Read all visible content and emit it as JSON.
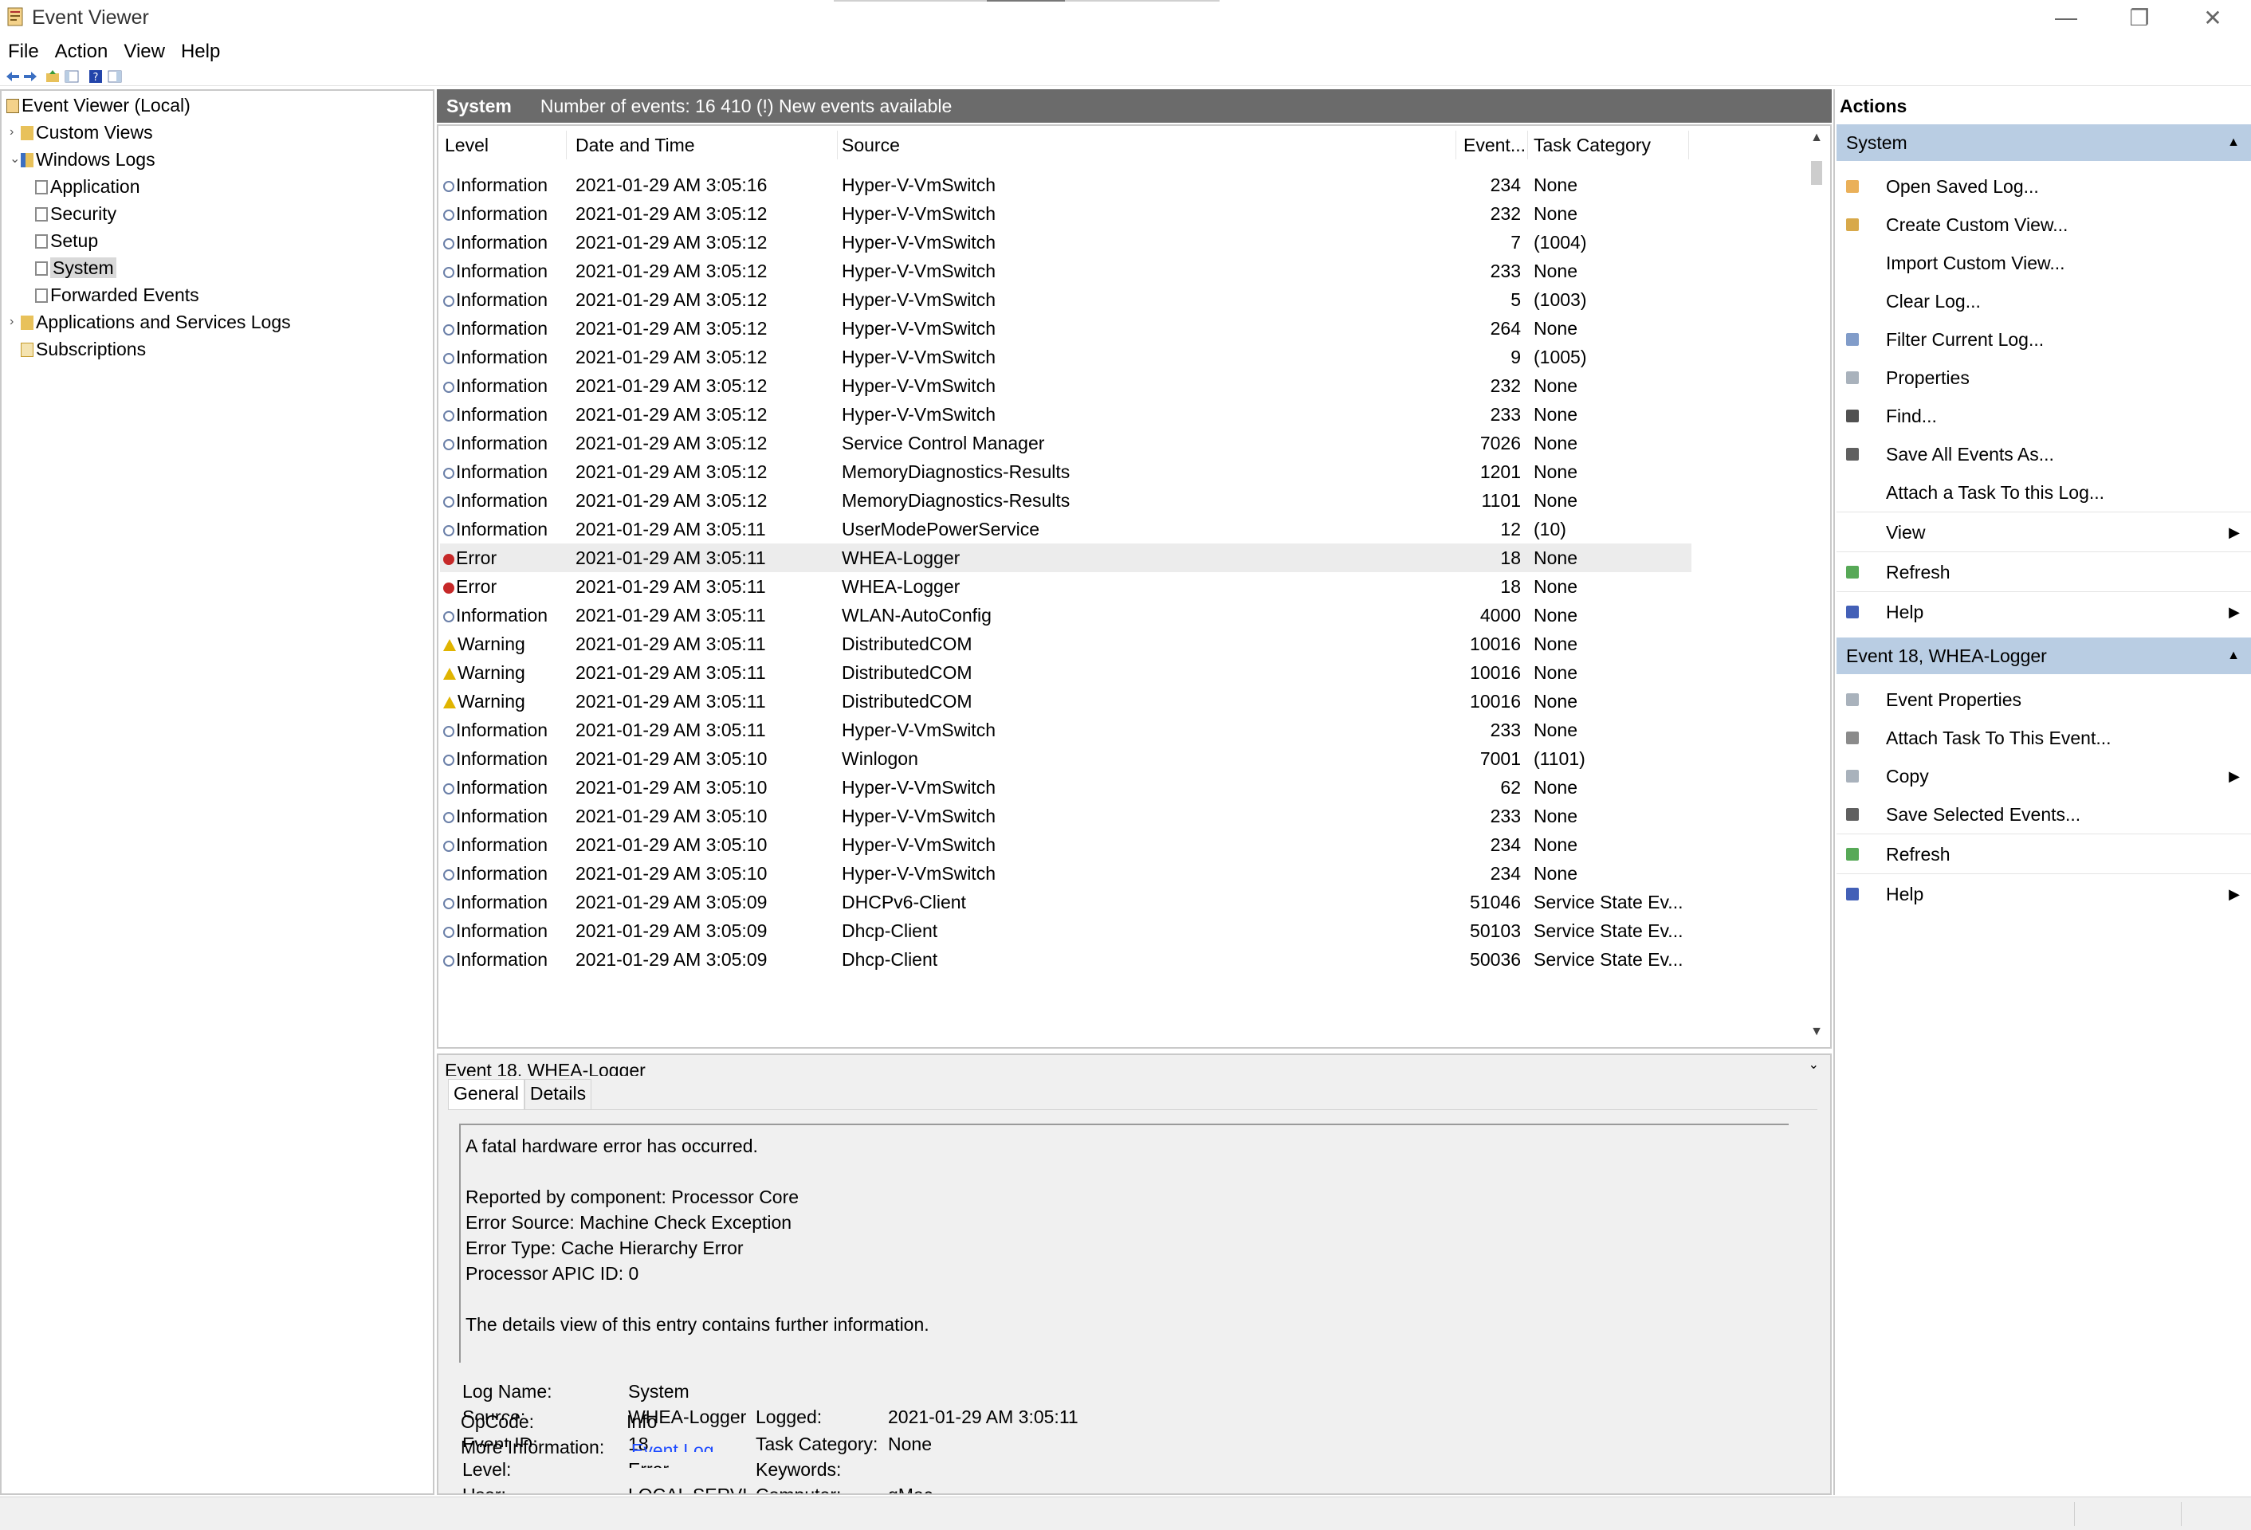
{
  "window": {
    "title": "Event Viewer",
    "controls": [
      "—",
      "❐",
      "✕"
    ]
  },
  "menu": [
    "File",
    "Action",
    "View",
    "Help"
  ],
  "tree": {
    "root": "Event Viewer (Local)",
    "custom_views": "Custom Views",
    "windows_logs": "Windows Logs",
    "application": "Application",
    "security": "Security",
    "setup": "Setup",
    "system": "System",
    "forwarded": "Forwarded Events",
    "app_services": "Applications and Services Logs",
    "subscriptions": "Subscriptions"
  },
  "header": {
    "log": "System",
    "count_text": "Number of events: 16 410 (!) New events available"
  },
  "columns": {
    "level": "Level",
    "date": "Date and Time",
    "source": "Source",
    "event": "Event...",
    "task": "Task Category"
  },
  "events": [
    {
      "level": "Information",
      "kind": "info",
      "date": "2021-01-29 AM 3:05:16",
      "source": "Hyper-V-VmSwitch",
      "id": "234",
      "task": "None"
    },
    {
      "level": "Information",
      "kind": "info",
      "date": "2021-01-29 AM 3:05:12",
      "source": "Hyper-V-VmSwitch",
      "id": "232",
      "task": "None"
    },
    {
      "level": "Information",
      "kind": "info",
      "date": "2021-01-29 AM 3:05:12",
      "source": "Hyper-V-VmSwitch",
      "id": "7",
      "task": "(1004)"
    },
    {
      "level": "Information",
      "kind": "info",
      "date": "2021-01-29 AM 3:05:12",
      "source": "Hyper-V-VmSwitch",
      "id": "233",
      "task": "None"
    },
    {
      "level": "Information",
      "kind": "info",
      "date": "2021-01-29 AM 3:05:12",
      "source": "Hyper-V-VmSwitch",
      "id": "5",
      "task": "(1003)"
    },
    {
      "level": "Information",
      "kind": "info",
      "date": "2021-01-29 AM 3:05:12",
      "source": "Hyper-V-VmSwitch",
      "id": "264",
      "task": "None"
    },
    {
      "level": "Information",
      "kind": "info",
      "date": "2021-01-29 AM 3:05:12",
      "source": "Hyper-V-VmSwitch",
      "id": "9",
      "task": "(1005)"
    },
    {
      "level": "Information",
      "kind": "info",
      "date": "2021-01-29 AM 3:05:12",
      "source": "Hyper-V-VmSwitch",
      "id": "232",
      "task": "None"
    },
    {
      "level": "Information",
      "kind": "info",
      "date": "2021-01-29 AM 3:05:12",
      "source": "Hyper-V-VmSwitch",
      "id": "233",
      "task": "None"
    },
    {
      "level": "Information",
      "kind": "info",
      "date": "2021-01-29 AM 3:05:12",
      "source": "Service Control Manager",
      "id": "7026",
      "task": "None"
    },
    {
      "level": "Information",
      "kind": "info",
      "date": "2021-01-29 AM 3:05:12",
      "source": "MemoryDiagnostics-Results",
      "id": "1201",
      "task": "None"
    },
    {
      "level": "Information",
      "kind": "info",
      "date": "2021-01-29 AM 3:05:12",
      "source": "MemoryDiagnostics-Results",
      "id": "1101",
      "task": "None"
    },
    {
      "level": "Information",
      "kind": "info",
      "date": "2021-01-29 AM 3:05:11",
      "source": "UserModePowerService",
      "id": "12",
      "task": "(10)"
    },
    {
      "level": "Error",
      "kind": "err",
      "date": "2021-01-29 AM 3:05:11",
      "source": "WHEA-Logger",
      "id": "18",
      "task": "None",
      "selected": true
    },
    {
      "level": "Error",
      "kind": "err",
      "date": "2021-01-29 AM 3:05:11",
      "source": "WHEA-Logger",
      "id": "18",
      "task": "None"
    },
    {
      "level": "Information",
      "kind": "info",
      "date": "2021-01-29 AM 3:05:11",
      "source": "WLAN-AutoConfig",
      "id": "4000",
      "task": "None"
    },
    {
      "level": "Warning",
      "kind": "warn",
      "date": "2021-01-29 AM 3:05:11",
      "source": "DistributedCOM",
      "id": "10016",
      "task": "None"
    },
    {
      "level": "Warning",
      "kind": "warn",
      "date": "2021-01-29 AM 3:05:11",
      "source": "DistributedCOM",
      "id": "10016",
      "task": "None"
    },
    {
      "level": "Warning",
      "kind": "warn",
      "date": "2021-01-29 AM 3:05:11",
      "source": "DistributedCOM",
      "id": "10016",
      "task": "None"
    },
    {
      "level": "Information",
      "kind": "info",
      "date": "2021-01-29 AM 3:05:11",
      "source": "Hyper-V-VmSwitch",
      "id": "233",
      "task": "None"
    },
    {
      "level": "Information",
      "kind": "info",
      "date": "2021-01-29 AM 3:05:10",
      "source": "Winlogon",
      "id": "7001",
      "task": "(1101)"
    },
    {
      "level": "Information",
      "kind": "info",
      "date": "2021-01-29 AM 3:05:10",
      "source": "Hyper-V-VmSwitch",
      "id": "62",
      "task": "None"
    },
    {
      "level": "Information",
      "kind": "info",
      "date": "2021-01-29 AM 3:05:10",
      "source": "Hyper-V-VmSwitch",
      "id": "233",
      "task": "None"
    },
    {
      "level": "Information",
      "kind": "info",
      "date": "2021-01-29 AM 3:05:10",
      "source": "Hyper-V-VmSwitch",
      "id": "234",
      "task": "None"
    },
    {
      "level": "Information",
      "kind": "info",
      "date": "2021-01-29 AM 3:05:10",
      "source": "Hyper-V-VmSwitch",
      "id": "234",
      "task": "None"
    },
    {
      "level": "Information",
      "kind": "info",
      "date": "2021-01-29 AM 3:05:09",
      "source": "DHCPv6-Client",
      "id": "51046",
      "task": "Service State Ev..."
    },
    {
      "level": "Information",
      "kind": "info",
      "date": "2021-01-29 AM 3:05:09",
      "source": "Dhcp-Client",
      "id": "50103",
      "task": "Service State Ev..."
    },
    {
      "level": "Information",
      "kind": "info",
      "date": "2021-01-29 AM 3:05:09",
      "source": "Dhcp-Client",
      "id": "50036",
      "task": "Service State Ev..."
    }
  ],
  "detail": {
    "title": "Event 18, WHEA-Logger",
    "tabs": {
      "general": "General",
      "details": "Details"
    },
    "message": [
      "A fatal hardware error has occurred.",
      "",
      "Reported by component: Processor Core",
      "Error Source: Machine Check Exception",
      "Error Type: Cache Hierarchy Error",
      "Processor APIC ID: 0",
      "",
      "The details view of this entry contains further information."
    ],
    "labels": {
      "log_name": "Log Name:",
      "source": "Source:",
      "event_id": "Event ID:",
      "level": "Level:",
      "user": "User:",
      "opcode": "OpCode:",
      "more_info": "More Information:",
      "logged": "Logged:",
      "task_category": "Task Category:",
      "keywords": "Keywords:",
      "computer": "Computer:"
    },
    "values": {
      "log_name": "System",
      "source": "WHEA-Logger",
      "event_id": "18",
      "level": "Error",
      "user": "LOCAL SERVICE",
      "opcode": "Info",
      "more_info": "Event Log Online Help",
      "logged": "2021-01-29 AM 3:05:11",
      "task_category": "None",
      "keywords": "",
      "computer": "gMac"
    }
  },
  "actions": {
    "title": "Actions",
    "section1": "System",
    "items1": [
      {
        "label": "Open Saved Log...",
        "icon": "folder-icon",
        "color": "#e6a23c"
      },
      {
        "label": "Create Custom View...",
        "icon": "filter-icon",
        "color": "#d19a2a"
      },
      {
        "label": "Import Custom View...",
        "icon": "",
        "color": ""
      },
      {
        "label": "Clear Log...",
        "icon": "",
        "color": ""
      },
      {
        "label": "Filter Current Log...",
        "icon": "filter-icon",
        "color": "#6b8bbf"
      },
      {
        "label": "Properties",
        "icon": "properties-icon",
        "color": "#9aa4b0"
      },
      {
        "label": "Find...",
        "icon": "binoculars-icon",
        "color": "#333"
      },
      {
        "label": "Save All Events As...",
        "icon": "save-icon",
        "color": "#444"
      },
      {
        "label": "Attach a Task To this Log...",
        "icon": "",
        "color": ""
      },
      {
        "label": "View",
        "icon": "",
        "color": "",
        "submenu": true
      },
      {
        "label": "Refresh",
        "icon": "refresh-icon",
        "color": "#3a9a3a"
      },
      {
        "label": "Help",
        "icon": "help-icon",
        "color": "#2244aa",
        "submenu": true
      }
    ],
    "section2": "Event 18, WHEA-Logger",
    "items2": [
      {
        "label": "Event Properties",
        "icon": "properties-icon",
        "color": "#9aa4b0"
      },
      {
        "label": "Attach Task To This Event...",
        "icon": "task-icon",
        "color": "#777"
      },
      {
        "label": "Copy",
        "icon": "copy-icon",
        "color": "#9aa4b0",
        "submenu": true
      },
      {
        "label": "Save Selected Events...",
        "icon": "save-icon",
        "color": "#444"
      },
      {
        "label": "Refresh",
        "icon": "refresh-icon",
        "color": "#3a9a3a"
      },
      {
        "label": "Help",
        "icon": "help-icon",
        "color": "#2244aa",
        "submenu": true
      }
    ]
  },
  "colors": {
    "header_bar": "#6b6b6b",
    "action_section": "#b9cde3",
    "selected_row": "#ececec",
    "error": "#c62828",
    "warning": "#e0b400"
  }
}
